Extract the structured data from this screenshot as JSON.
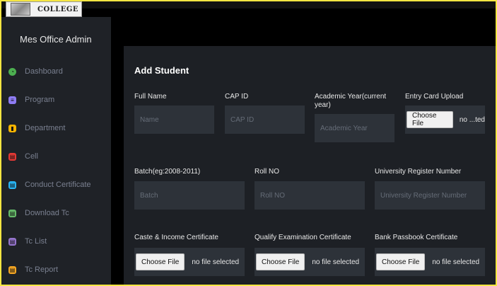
{
  "logo": {
    "text": "COLLEGE"
  },
  "sidebar": {
    "brand": "Mes Office Admin",
    "items": [
      {
        "label": "Dashboard",
        "icon": "dashboard-icon",
        "color": "#4caf50"
      },
      {
        "label": "Program",
        "icon": "program-icon",
        "color": "#8e7cf3"
      },
      {
        "label": "Department",
        "icon": "chart-icon",
        "color": "#f5b400"
      },
      {
        "label": "Cell",
        "icon": "cell-icon",
        "color": "#e53935"
      },
      {
        "label": "Conduct Certificate",
        "icon": "certificate-icon",
        "color": "#29b6f6"
      },
      {
        "label": "Download Tc",
        "icon": "download-icon",
        "color": "#66bb6a"
      },
      {
        "label": "Tc List",
        "icon": "list-icon",
        "color": "#9575cd"
      },
      {
        "label": "Tc Report",
        "icon": "report-icon",
        "color": "#f5a623"
      }
    ]
  },
  "form": {
    "title": "Add Student",
    "full_name": {
      "label": "Full Name",
      "placeholder": "Name"
    },
    "cap_id": {
      "label": "CAP ID",
      "placeholder": "CAP ID"
    },
    "academic_year": {
      "label": "Academic Year(current year)",
      "placeholder": "Academic Year"
    },
    "entry_card": {
      "label": "Entry Card Upload",
      "button": "Choose File",
      "status": "no ...ted"
    },
    "batch": {
      "label": "Batch(eg:2008-2011)",
      "placeholder": "Batch"
    },
    "roll_no": {
      "label": "Roll NO",
      "placeholder": "Roll NO"
    },
    "university_reg": {
      "label": "University Register Number",
      "placeholder": "University Register Number"
    },
    "caste_income": {
      "label": "Caste & Income Certificate",
      "button": "Choose File",
      "status": "no file selected"
    },
    "qualify_exam": {
      "label": "Qualify Examination Certificate",
      "button": "Choose File",
      "status": "no file selected"
    },
    "bank_passbook": {
      "label": "Bank Passbook Certificate",
      "button": "Choose File",
      "status": "no file selected"
    }
  }
}
